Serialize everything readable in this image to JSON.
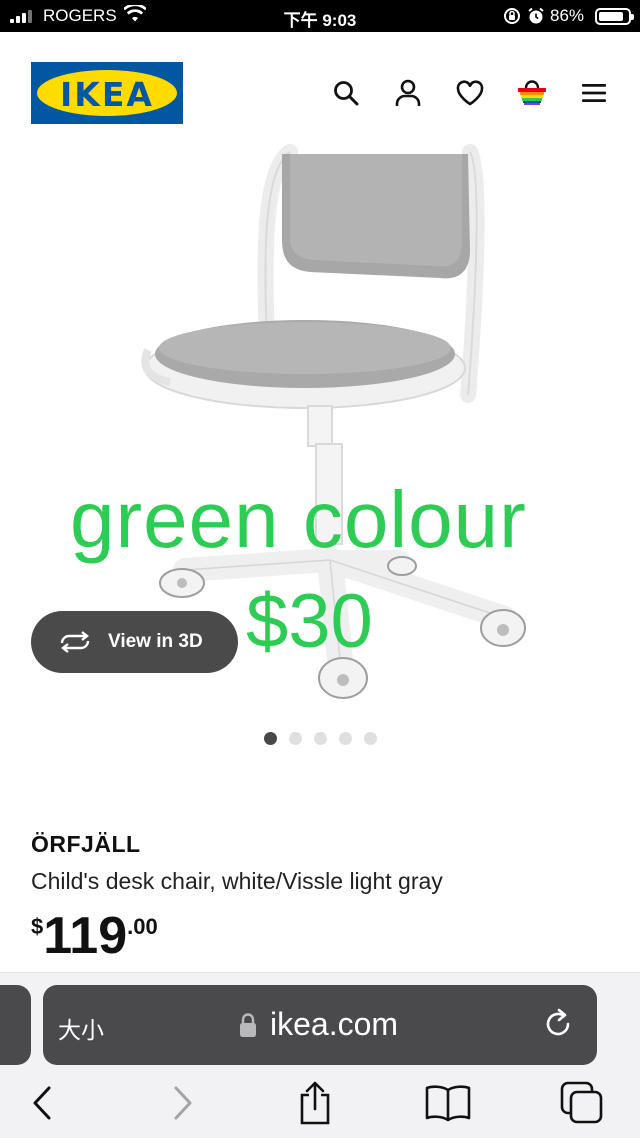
{
  "status_bar": {
    "carrier": "ROGERS",
    "time": "下午 9:03",
    "battery_percent": "86%",
    "battery_level": 0.86
  },
  "header": {
    "logo_text": "IKEA",
    "icons": [
      "search-icon",
      "profile-icon",
      "heart-icon",
      "basket-icon",
      "menu-icon"
    ]
  },
  "overlay": {
    "line1": "green colour",
    "line2": "$30",
    "color": "#2ecc55"
  },
  "gallery": {
    "view_3d_label": "View in 3D",
    "image_count": 5,
    "active_index": 0
  },
  "product": {
    "name": "ÖRFJÄLL",
    "description": "Child's desk chair, white/Vissle light gray",
    "price_currency": "$",
    "price_integer": "119",
    "price_decimals": ".00"
  },
  "browser": {
    "text_size_label": "大小",
    "domain": "ikea.com"
  },
  "colors": {
    "ikea_blue": "#0058a3",
    "ikea_yellow": "#ffdb00"
  }
}
